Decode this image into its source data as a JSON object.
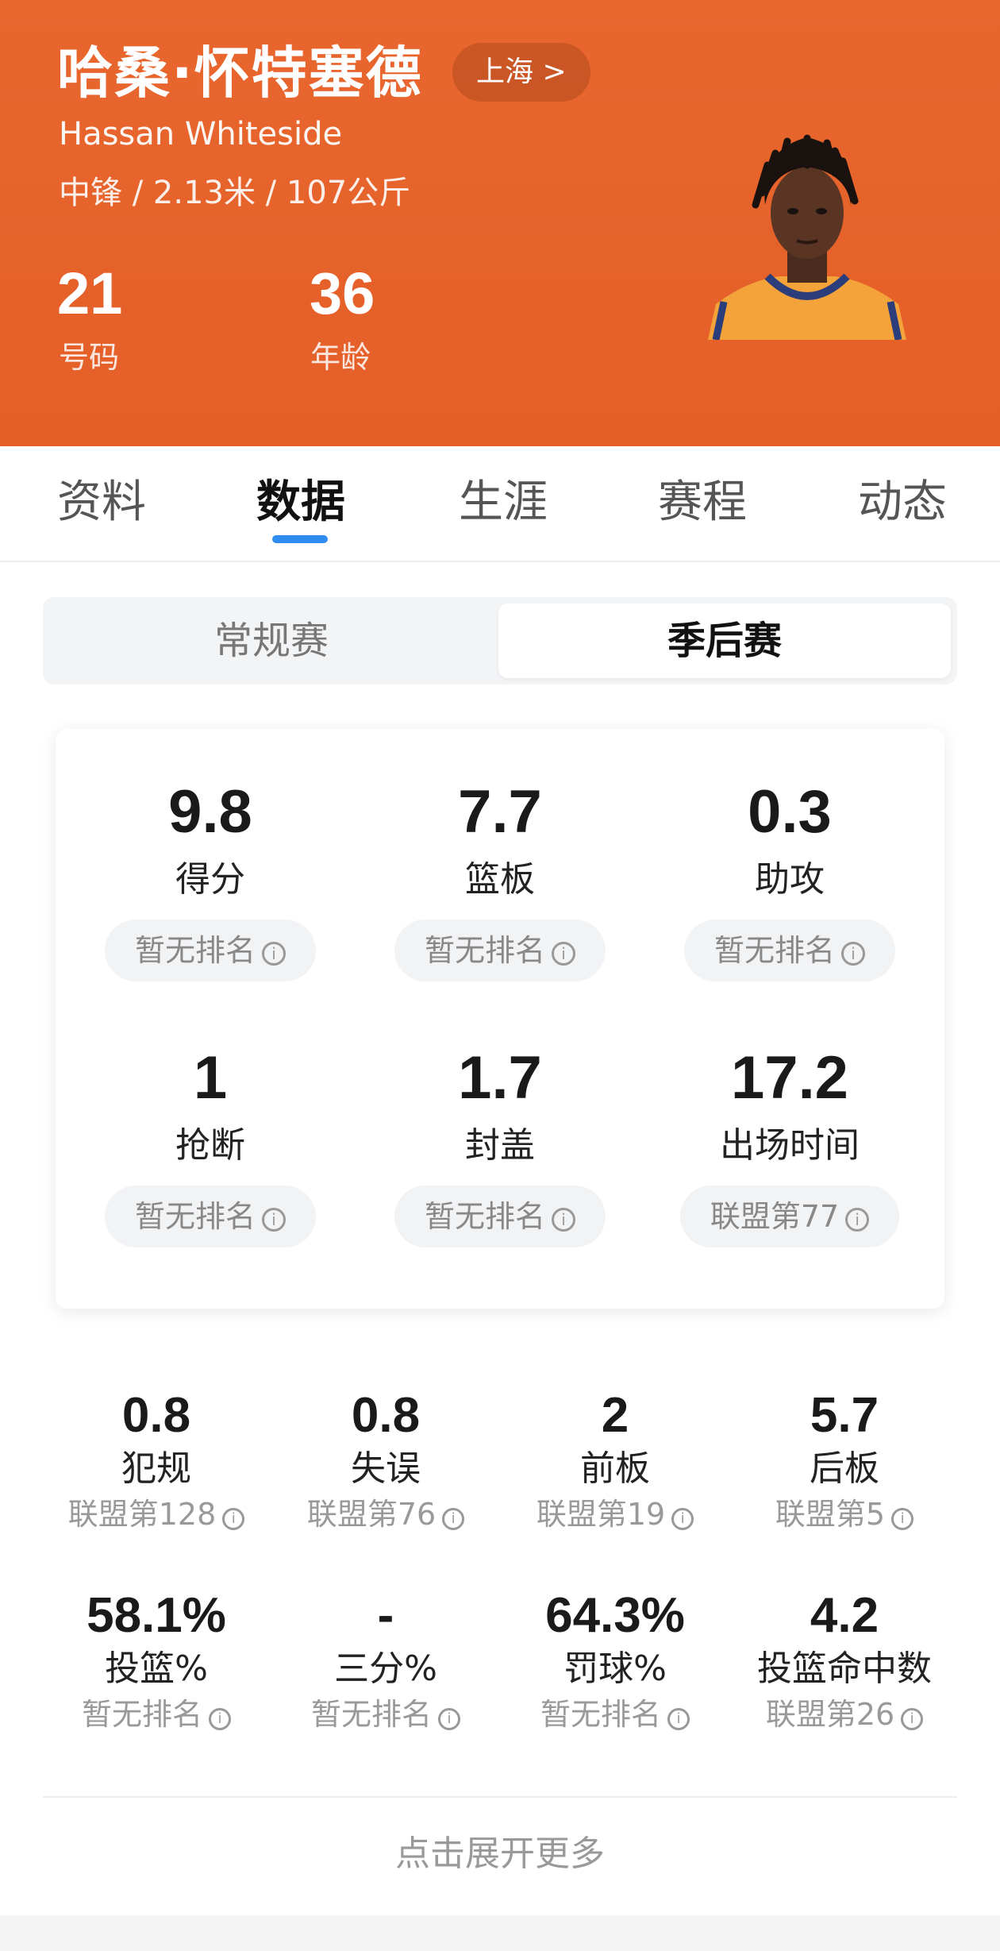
{
  "player": {
    "name_cn": "哈桑·怀特塞德",
    "name_en": "Hassan Whiteside",
    "team_label": "上海 >",
    "bio": "中锋 / 2.13米 / 107公斤",
    "number": "21",
    "number_label": "号码",
    "age": "36",
    "age_label": "年龄"
  },
  "colors": {
    "header_bg": "#e8672f",
    "tab_indicator": "#2f8cf0",
    "jersey": "#f4a23a",
    "jersey_trim": "#2b3d7a"
  },
  "tabs": [
    {
      "label": "资料",
      "active": false
    },
    {
      "label": "数据",
      "active": true
    },
    {
      "label": "生涯",
      "active": false
    },
    {
      "label": "赛程",
      "active": false
    },
    {
      "label": "动态",
      "active": false
    }
  ],
  "season_toggle": {
    "options": [
      "常规赛",
      "季后赛"
    ],
    "selected": "季后赛"
  },
  "main_stats": [
    {
      "value": "9.8",
      "label": "得分",
      "rank": "暂无排名"
    },
    {
      "value": "7.7",
      "label": "篮板",
      "rank": "暂无排名"
    },
    {
      "value": "0.3",
      "label": "助攻",
      "rank": "暂无排名"
    },
    {
      "value": "1",
      "label": "抢断",
      "rank": "暂无排名"
    },
    {
      "value": "1.7",
      "label": "封盖",
      "rank": "暂无排名"
    },
    {
      "value": "17.2",
      "label": "出场时间",
      "rank": "联盟第77"
    }
  ],
  "secondary_stats": [
    {
      "value": "0.8",
      "label": "犯规",
      "rank": "联盟第128"
    },
    {
      "value": "0.8",
      "label": "失误",
      "rank": "联盟第76"
    },
    {
      "value": "2",
      "label": "前板",
      "rank": "联盟第19"
    },
    {
      "value": "5.7",
      "label": "后板",
      "rank": "联盟第5"
    },
    {
      "value": "58.1%",
      "label": "投篮%",
      "rank": "暂无排名"
    },
    {
      "value": "-",
      "label": "三分%",
      "rank": "暂无排名"
    },
    {
      "value": "64.3%",
      "label": "罚球%",
      "rank": "暂无排名"
    },
    {
      "value": "4.2",
      "label": "投篮命中数",
      "rank": "联盟第26"
    }
  ],
  "icons": {
    "info": "ⓘ"
  },
  "expand_label": "点击展开更多"
}
